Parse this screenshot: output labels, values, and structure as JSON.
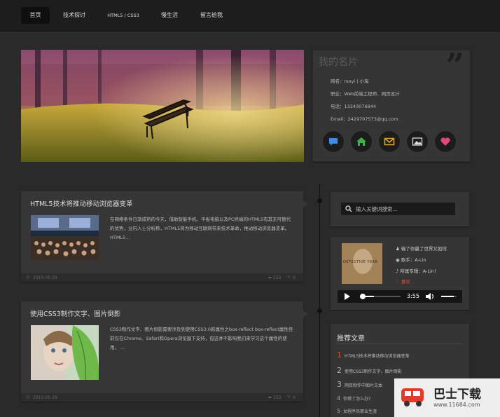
{
  "nav": {
    "items": [
      "首页",
      "技术探讨",
      "HTML5 / CSS3",
      "慢生活",
      "留言给我"
    ]
  },
  "profile": {
    "title": "我的名片",
    "quote": "”",
    "name": "网名：rsoyi | 小淘",
    "job": "职业：Web前端工程师、网页设计",
    "phone": "电话：13243076944",
    "email": "Email：2429707573@qq.com",
    "icons": [
      "chat-icon",
      "home-icon",
      "mail-icon",
      "picture-icon",
      "heart-icon"
    ]
  },
  "posts": [
    {
      "title": "HTML5技术将推动移动浏览器变革",
      "excerpt": "在网络条件日渐成熟的今天，借助智能手机、平板电脑以及PC终端的HTML5有其无可替代的优势，业内人士分析称，HTML5将为移动互联网带来技术革命，推动移动浏览器变革。 HTML5...",
      "date": "2015-05-29",
      "views": "250",
      "comments": "0"
    },
    {
      "title": "使用CSS3制作文字、图片倒影",
      "excerpt": "CSS3制作文字、图片倒影需要涉及到使用CSS3.0新属性之box-reflect box-reflect属性目前仅在Chrome、Safari和Opera浏览器下支持，但这并不影响我们来学习这个属性的使用。 ...",
      "date": "2015-05-29",
      "views": "153",
      "comments": "0"
    }
  ],
  "search": {
    "placeholder": "输入关键词搜索..."
  },
  "music": {
    "song": "输了你赢了世界又如何",
    "singer": "歌手：A-Lin",
    "album": "所属专辑：A-Lin！",
    "like": "喜欢",
    "time": "3:55",
    "progress": 0.35,
    "volume": 0.8,
    "cover_text": "DETECTIVE YEAR"
  },
  "recommend": {
    "title": "推荐文章",
    "items": [
      {
        "num": "1",
        "text": "HTML5技术将推动移动浏览器变革"
      },
      {
        "num": "2",
        "text": "使用CSS3制作文字、图片倒影"
      },
      {
        "num": "3",
        "text": "网页制作中图片文本"
      },
      {
        "num": "4",
        "text": "你错了怎么办？"
      },
      {
        "num": "5",
        "text": "女程序员职业生涯"
      }
    ]
  },
  "watermark": {
    "brand": "巴士下载",
    "url": "www.11684.com"
  },
  "colors": {
    "accent_red": "#e14a2a",
    "chat_blue": "#3a8ee6",
    "home_green": "#3cb34a",
    "mail_orange": "#f0a030",
    "heart_pink": "#e0457b",
    "like_red": "#e0503a"
  }
}
